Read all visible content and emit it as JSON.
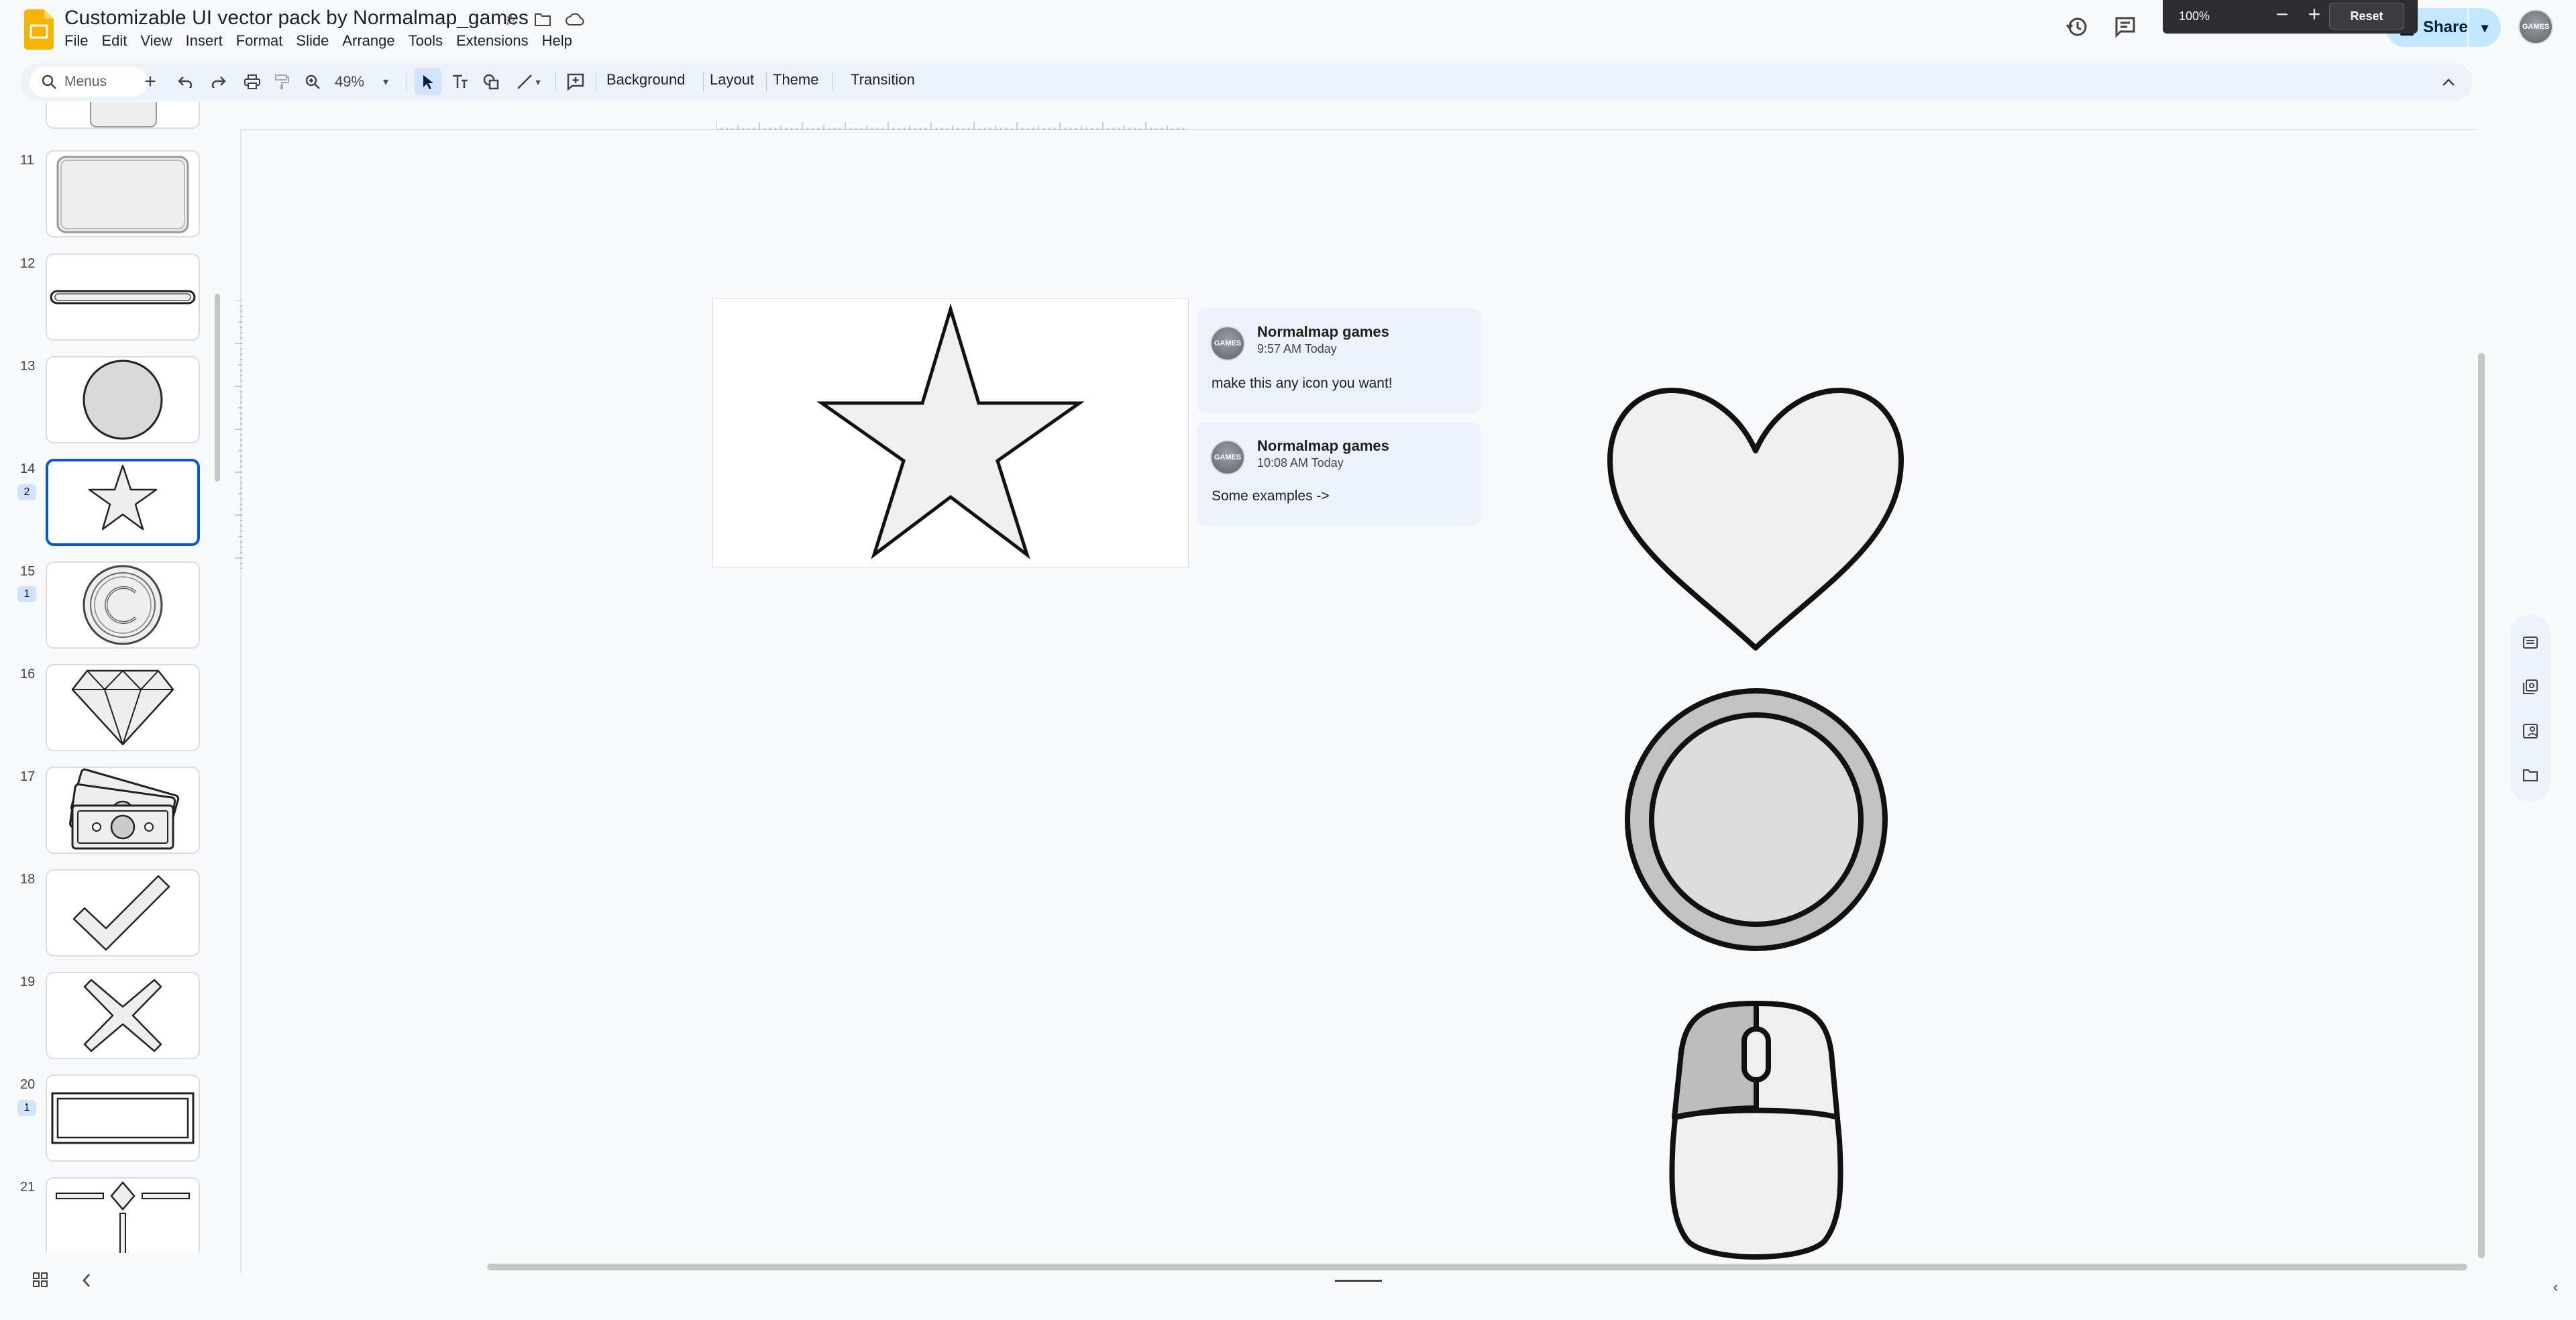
{
  "document": {
    "title": "Customizable UI vector pack by Normalmap_games"
  },
  "menu": [
    "File",
    "Edit",
    "View",
    "Insert",
    "Format",
    "Slide",
    "Arrange",
    "Tools",
    "Extensions",
    "Help"
  ],
  "zoom_popup": {
    "value": "100%",
    "reset_label": "Reset"
  },
  "share": {
    "label": "Share"
  },
  "avatar": {
    "text": "GAMES"
  },
  "toolbar": {
    "search_placeholder": "Menus",
    "zoom": "49%",
    "background": "Background",
    "layout": "Layout",
    "theme": "Theme",
    "transition": "Transition"
  },
  "slides": [
    {
      "number": "11",
      "shape": "rounded-rect"
    },
    {
      "number": "12",
      "shape": "bar"
    },
    {
      "number": "13",
      "shape": "circle"
    },
    {
      "number": "14",
      "shape": "star",
      "selected": true,
      "badge": "2"
    },
    {
      "number": "15",
      "shape": "copyright",
      "badge": "1"
    },
    {
      "number": "16",
      "shape": "diamond"
    },
    {
      "number": "17",
      "shape": "money"
    },
    {
      "number": "18",
      "shape": "check"
    },
    {
      "number": "19",
      "shape": "cross"
    },
    {
      "number": "20",
      "shape": "frame",
      "badge": "1"
    },
    {
      "number": "21",
      "shape": "divider"
    }
  ],
  "comments": [
    {
      "author": "Normalmap games",
      "time": "9:57 AM Today",
      "text": "make this any icon you want!"
    },
    {
      "author": "Normalmap games",
      "time": "10:08 AM Today",
      "text": "Some examples ->"
    }
  ],
  "example_icons": [
    "heart-icon",
    "coin-icon",
    "mouse-icon"
  ]
}
